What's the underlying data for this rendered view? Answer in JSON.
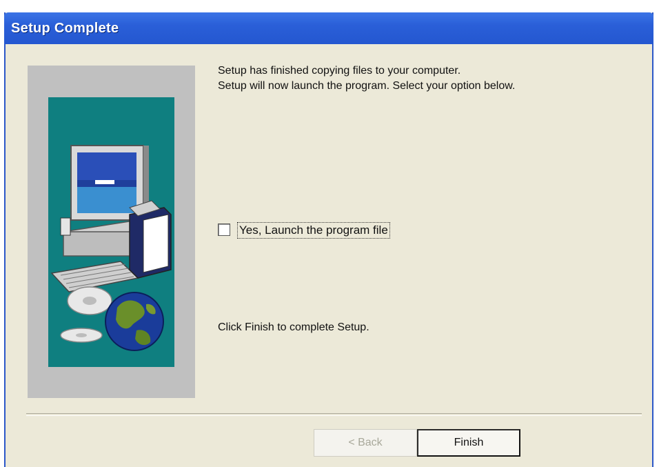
{
  "window": {
    "title": "Setup Complete"
  },
  "content": {
    "line1": "Setup has finished copying files to your computer.",
    "line2": "Setup will now launch the program. Select your option below.",
    "checkbox_label": "Yes, Launch the program file",
    "checkbox_checked": false,
    "finish_hint": "Click Finish to complete Setup."
  },
  "buttons": {
    "back": "< Back",
    "finish": "Finish"
  },
  "colors": {
    "titlebar": "#2a5fd8",
    "panel_background": "#c0c0c0",
    "art_background": "#0f7f80",
    "dialog_background": "#ece9d8"
  },
  "icons": {
    "side_art": "computer-with-cds-and-globe-illustration"
  }
}
